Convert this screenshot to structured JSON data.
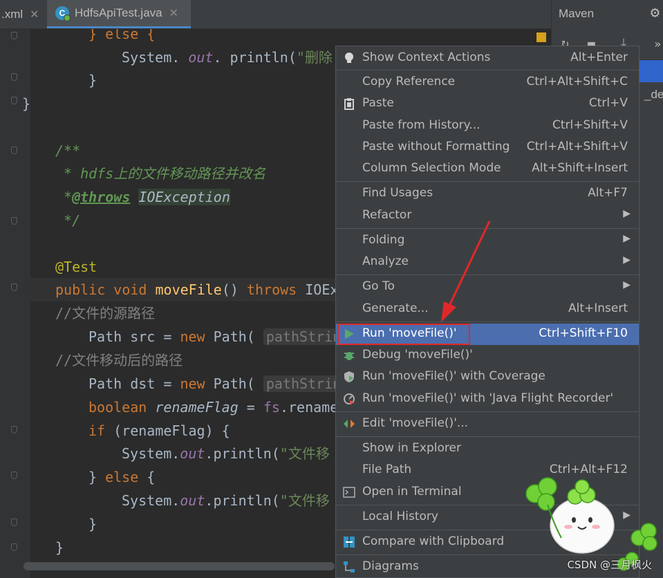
{
  "tabs": [
    {
      "label": ".xml",
      "active": false
    },
    {
      "label": "HdfsApiTest.java",
      "active": true
    }
  ],
  "close_glyph": "✕",
  "file_icon_letter": "C",
  "maven": {
    "title": "Maven",
    "fragment": "_der",
    "more": "»"
  },
  "code": {
    "l1": "} else {",
    "l2_pre": "System. ",
    "l2_out": "out",
    "l2_mid": ". println(",
    "l2_str": "\"删除",
    "l3": "}",
    "l4": "}",
    "doc_open": "/**",
    "doc_line_star": " * ",
    "doc_line_text": "hdfs上的文件移动路径并改名",
    "doc_throws_star": " *",
    "doc_throws_tag": "@throws",
    "doc_throws_type": "IOException",
    "doc_close": " */",
    "annotation": "@Test",
    "sig_public": "public ",
    "sig_void": "void ",
    "sig_name": "moveFile",
    "sig_parens": "() ",
    "sig_throws": "throws ",
    "sig_type": "IOEx",
    "comment1": "//文件的源路径",
    "src_pre": "Path src = ",
    "new_kw": "new ",
    "path_call": "Path(",
    "hint": "pathString",
    "comment2": "//文件移动后的路径",
    "dst_pre": "Path dst = ",
    "hint2": "pathString",
    "bool_kw": "boolean ",
    "bool_var": "renameFlag = ",
    "fs": "fs",
    "rename": ".rename",
    "if_kw": "if ",
    "if_rest": "(renameFlag) {",
    "sys1_pre": "System.",
    "sys_out": "out",
    "println": ".println(",
    "str_move": "\"文件移",
    "else_kw": "else",
    "brace_close": "}",
    "else_pre": "} ",
    "else_post": " {"
  },
  "menu": [
    {
      "label": "Show Context Actions",
      "shortcut": "Alt+Enter",
      "icon": "bulb-icon"
    },
    {
      "label": "Copy Reference",
      "shortcut": "Ctrl+Alt+Shift+C"
    },
    {
      "label": "Paste",
      "shortcut": "Ctrl+V",
      "icon": "clipboard-icon"
    },
    {
      "label": "Paste from History...",
      "shortcut": "Ctrl+Shift+V"
    },
    {
      "label": "Paste without Formatting",
      "shortcut": "Ctrl+Alt+Shift+V"
    },
    {
      "label": "Column Selection Mode",
      "shortcut": "Alt+Shift+Insert"
    },
    {
      "label": "Find Usages",
      "shortcut": "Alt+F7"
    },
    {
      "label": "Refactor",
      "submenu": true
    },
    {
      "label": "Folding",
      "submenu": true
    },
    {
      "label": "Analyze",
      "submenu": true
    },
    {
      "label": "Go To",
      "submenu": true
    },
    {
      "label": "Generate...",
      "shortcut": "Alt+Insert"
    },
    {
      "label": "Run 'moveFile()'",
      "shortcut": "Ctrl+Shift+F10",
      "icon": "run-icon",
      "highlighted": true
    },
    {
      "label": "Debug 'moveFile()'",
      "icon": "debug-icon"
    },
    {
      "label": "Run 'moveFile()' with Coverage",
      "icon": "coverage-icon"
    },
    {
      "label": "Run 'moveFile()' with 'Java Flight Recorder'",
      "icon": "profiler-icon"
    },
    {
      "label": "Edit 'moveFile()'...",
      "icon": "edit-config-icon"
    },
    {
      "label": "Show in Explorer"
    },
    {
      "label": "File Path",
      "shortcut": "Ctrl+Alt+F12"
    },
    {
      "label": "Open in Terminal",
      "icon": "terminal-icon"
    },
    {
      "label": "Local History",
      "submenu": true
    },
    {
      "label": "Compare with Clipboard",
      "icon": "compare-icon"
    },
    {
      "label": "Diagrams",
      "icon": "diagram-icon"
    }
  ],
  "submenu_arrow": "▶",
  "watermark": "CSDN @三月枫火",
  "colors": {
    "accent": "#4b6eaf",
    "annotation_box": "#e0282a",
    "arrow": "#e0282a"
  }
}
